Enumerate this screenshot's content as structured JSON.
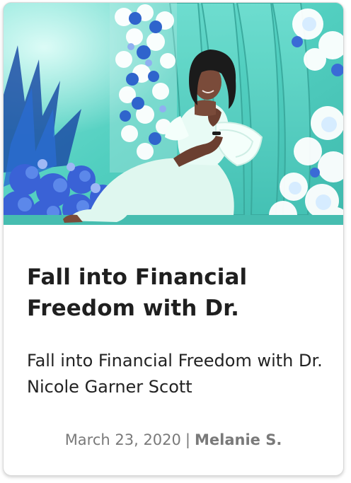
{
  "post": {
    "title": "Fall into Financial Freedom with Dr.",
    "excerpt": "Fall into Financial Freedom with Dr. Nicole Garner Scott",
    "date": "March 23, 2020",
    "separator": "|",
    "author": "Melanie S."
  },
  "image": {
    "subject": "photo-woman-in-white-dress-seated-among-blue-and-white-flowers",
    "palette": {
      "background": "#5ed6c6",
      "flower_blue": "#2f5fc8",
      "dress": "#dff7ef",
      "hair": "#1b1b1b"
    }
  },
  "colors": {
    "title": "#1f1f1f",
    "text": "#222222",
    "meta": "#7a7a7a",
    "card_border": "#d9d9d9"
  }
}
